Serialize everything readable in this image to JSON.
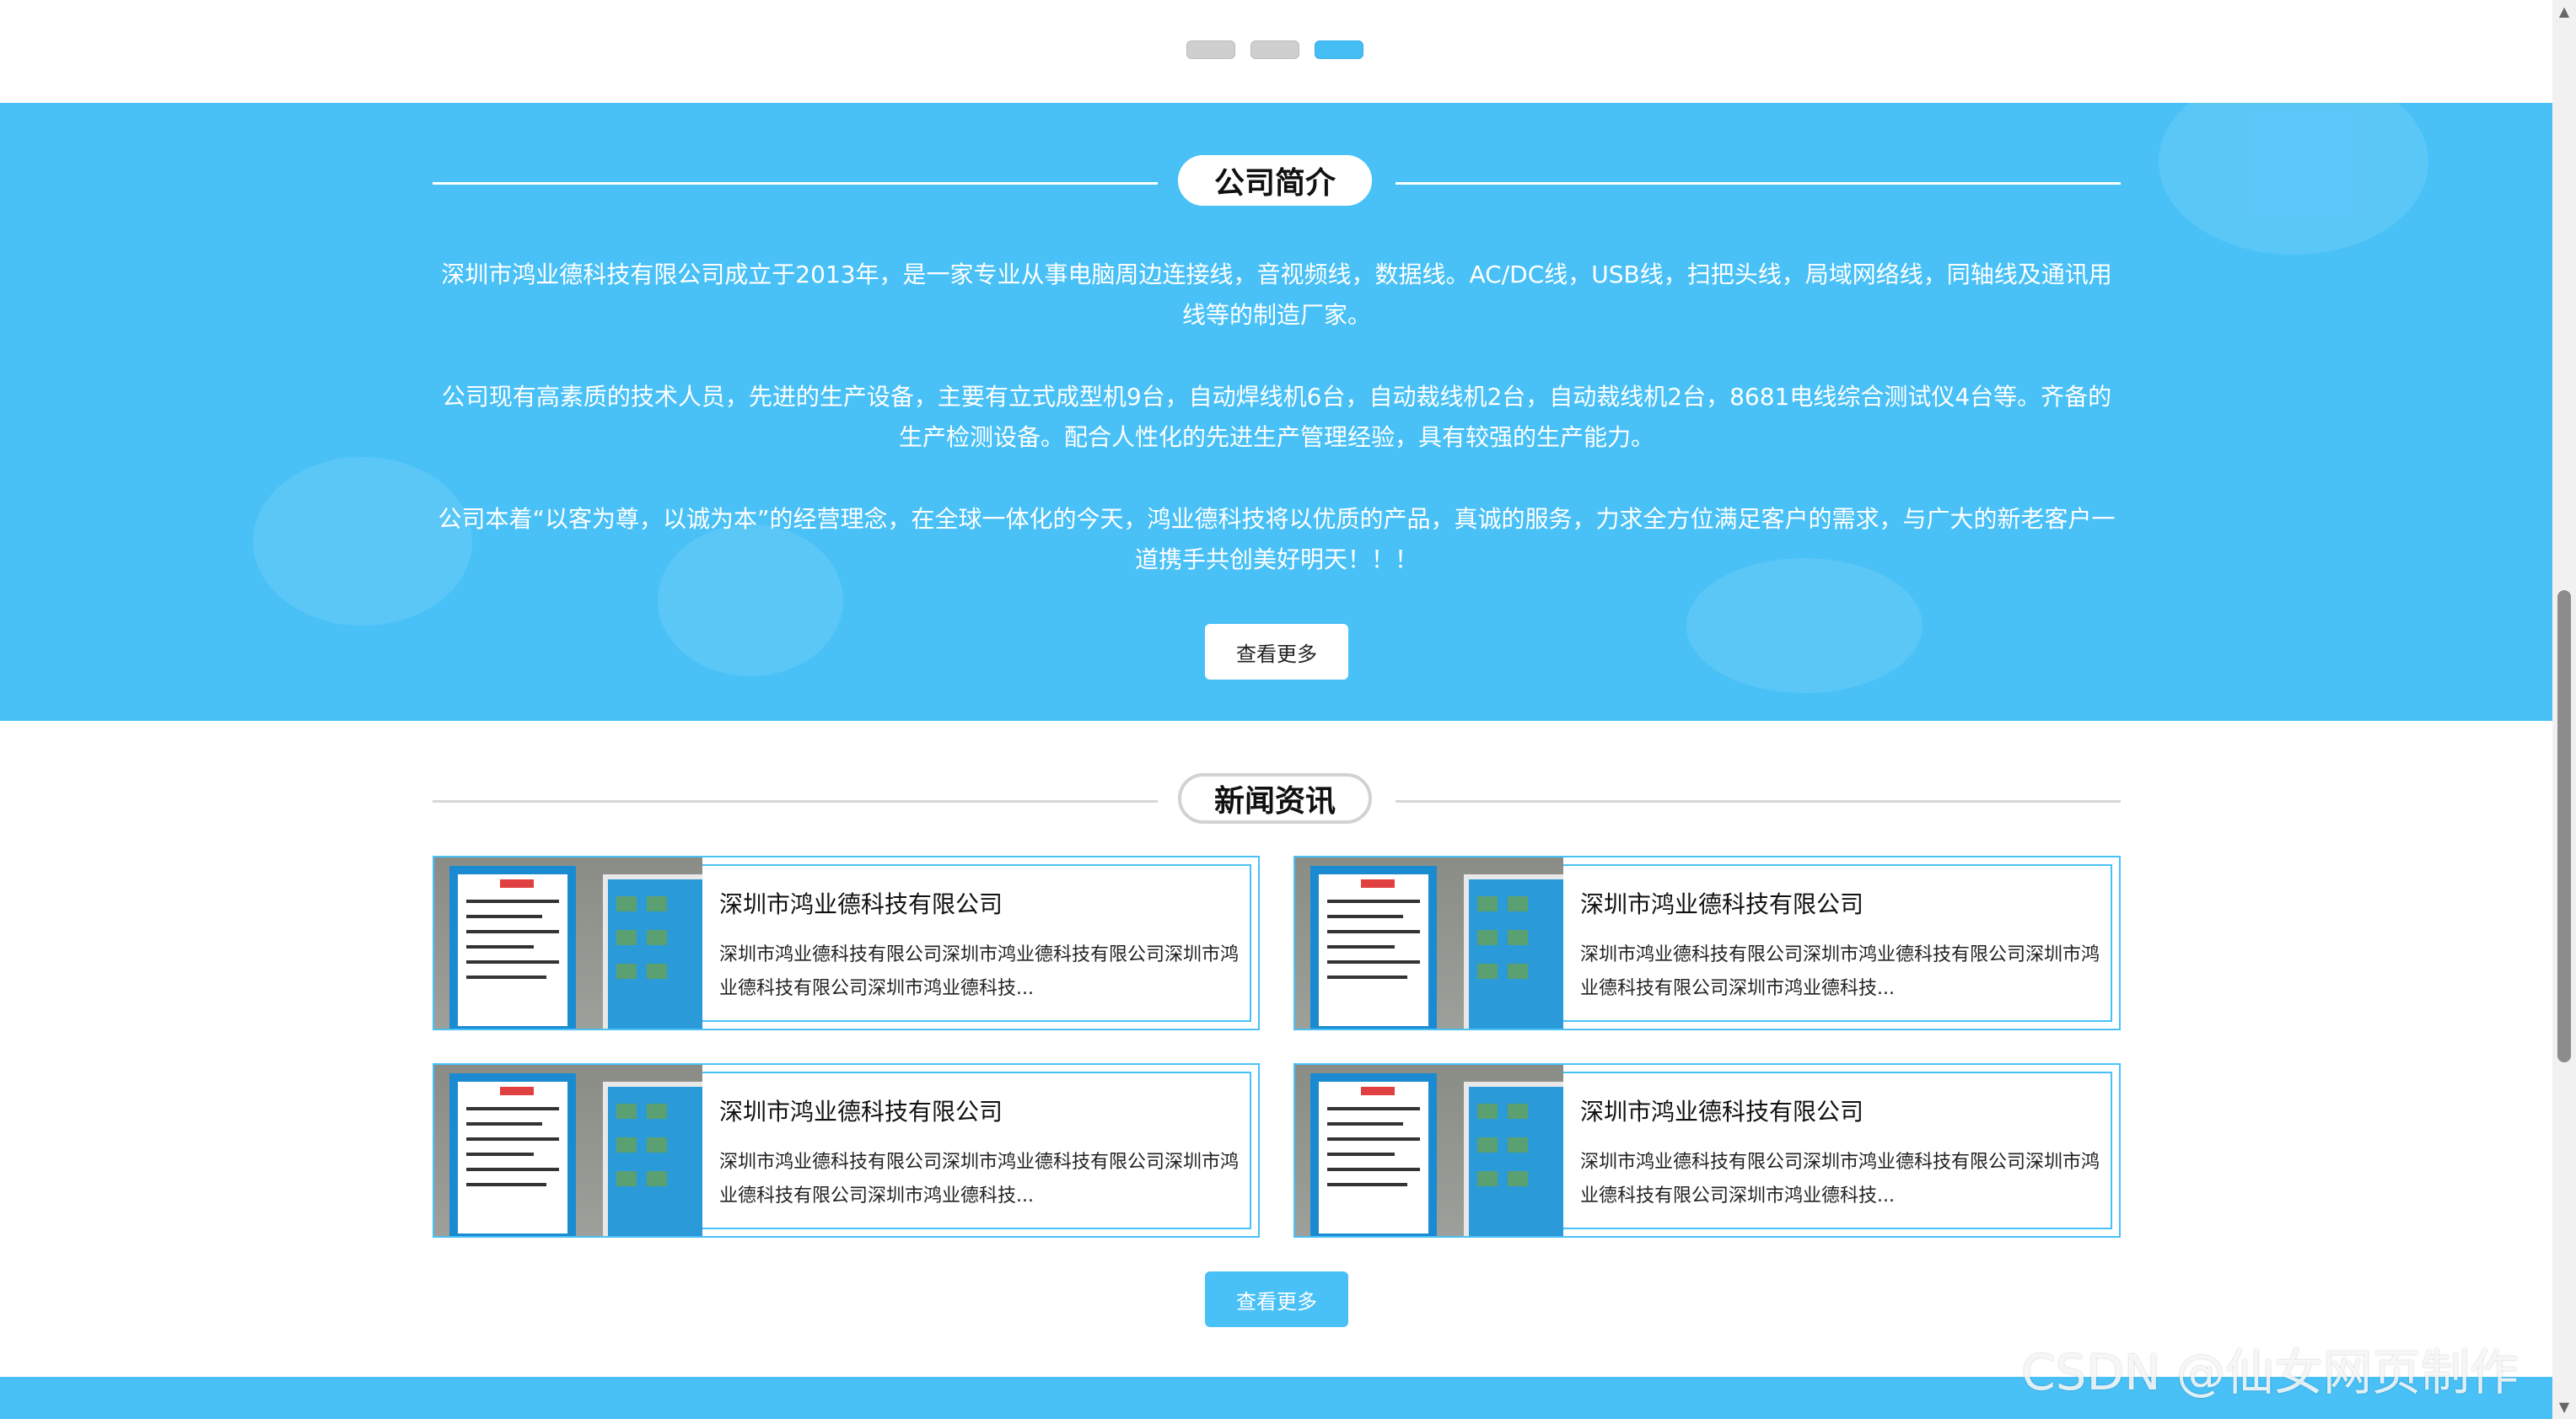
{
  "carousel": {
    "dot_count": 3,
    "active_index": 2
  },
  "about": {
    "heading": "公司简介",
    "paragraphs": [
      "深圳市鸿业德科技有限公司成立于2013年，是一家专业从事电脑周边连接线，音视频线，数据线。AC/DC线，USB线，扫把头线，局域网络线，同轴线及通讯用线等的制造厂家。",
      "公司现有高素质的技术人员，先进的生产设备，主要有立式成型机9台，自动焊线机6台，自动裁线机2台，自动裁线机2台，8681电线综合测试仪4台等。齐备的生产检测设备。配合人性化的先进生产管理经验，具有较强的生产能力。",
      "公司本着“以客为尊，以诚为本”的经营理念，在全球一体化的今天，鸿业德科技将以优质的产品，真诚的服务，力求全方位满足客户的需求，与广大的新老客户一道携手共创美好明天！！！"
    ],
    "more_label": "查看更多"
  },
  "news": {
    "heading": "新闻资讯",
    "items": [
      {
        "title": "深圳市鸿业德科技有限公司",
        "desc": "深圳市鸿业德科技有限公司深圳市鸿业德科技有限公司深圳市鸿业德科技有限公司深圳市鸿业德科技..."
      },
      {
        "title": "深圳市鸿业德科技有限公司",
        "desc": "深圳市鸿业德科技有限公司深圳市鸿业德科技有限公司深圳市鸿业德科技有限公司深圳市鸿业德科技..."
      },
      {
        "title": "深圳市鸿业德科技有限公司",
        "desc": "深圳市鸿业德科技有限公司深圳市鸿业德科技有限公司深圳市鸿业德科技有限公司深圳市鸿业德科技..."
      },
      {
        "title": "深圳市鸿业德科技有限公司",
        "desc": "深圳市鸿业德科技有限公司深圳市鸿业德科技有限公司深圳市鸿业德科技有限公司深圳市鸿业德科技..."
      }
    ],
    "more_label": "查看更多"
  },
  "watermark": "CSDN @仙女网页制作",
  "colors": {
    "accent": "#49c1f7",
    "dot_inactive": "#cfcfcf",
    "text_dark": "#111111"
  },
  "icons": {
    "scroll_up": "scroll-up-arrow-icon",
    "scroll_down": "scroll-down-arrow-icon"
  }
}
